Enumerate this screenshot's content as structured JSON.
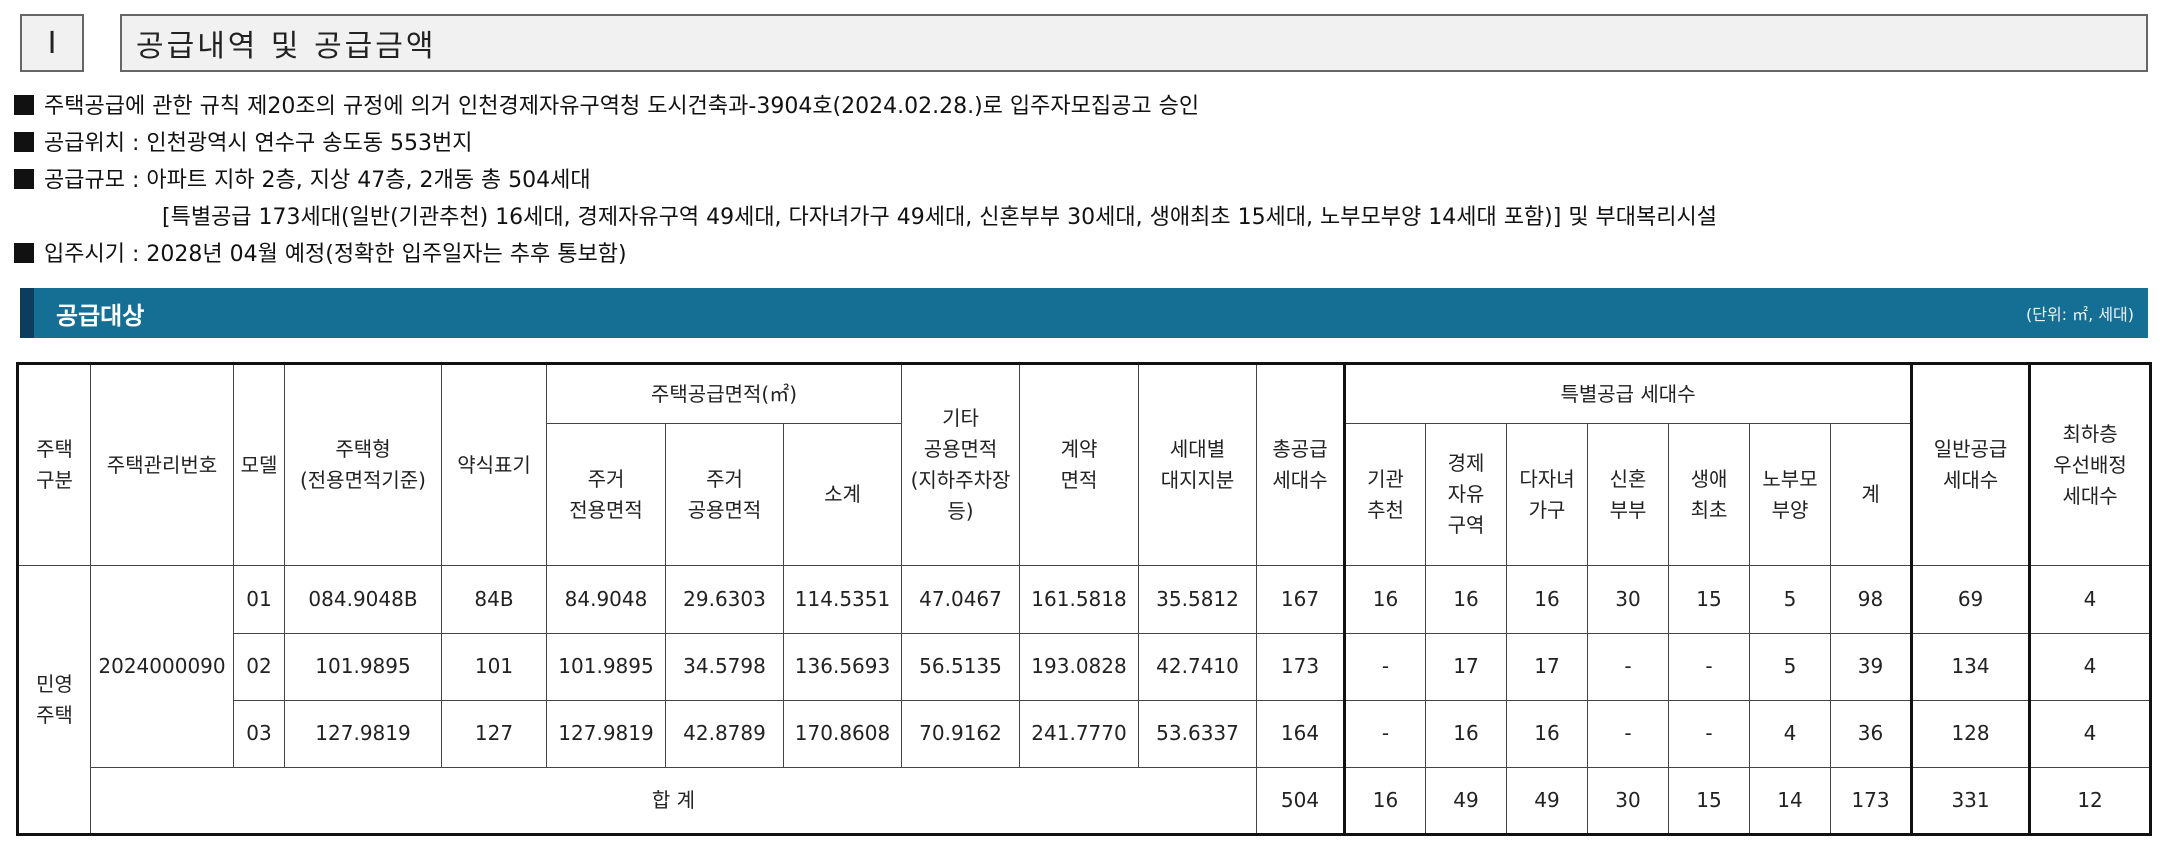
{
  "section": {
    "number": "Ⅰ",
    "title": "공급내역 및 공급금액"
  },
  "info": {
    "line1": "주택공급에 관한 규칙 제20조의 규정에 의거 인천경제자유구역청 도시건축과-3904호(2024.02.28.)로 입주자모집공고 승인",
    "line2": "공급위치 : 인천광역시 연수구 송도동 553번지",
    "line3": "공급규모 : 아파트 지하 2층, 지상 47층, 2개동 총 504세대",
    "line3b": "[특별공급 173세대(일반(기관추천) 16세대, 경제자유구역 49세대, 다자녀가구 49세대, 신혼부부 30세대, 생애최초 15세대, 노부모부양 14세대 포함)] 및 부대복리시설",
    "line4": "입주시기 : 2028년 04월 예정(정확한 입주일자는 추후 통보함)"
  },
  "bar": {
    "title": "공급대상",
    "unit": "(단위: ㎡, 세대)"
  },
  "table": {
    "headers": {
      "house_type_group": "주택\n구분",
      "mgmt_no": "주택관리번호",
      "model": "모델",
      "house_type": "주택형\n(전용면적기준)",
      "abbr": "약식표기",
      "area_group": "주택공급면적(㎡)",
      "exclusive": "주거\n전용면적",
      "shared": "주거\n공용면적",
      "subtotal": "소계",
      "other_shared": "기타\n공용면적\n(지하주차장\n등)",
      "contract_area": "계약\n면적",
      "land_share": "세대별\n대지지분",
      "total_supply": "총공급\n세대수",
      "special_group": "특별공급 세대수",
      "sp_agency": "기관\n추천",
      "sp_free_zone": "경제\n자유\n구역",
      "sp_multi_child": "다자녀\n가구",
      "sp_newlywed": "신혼\n부부",
      "sp_first": "생애\n최초",
      "sp_elderly": "노부모\n부양",
      "sp_sum": "계",
      "general": "일반공급\n세대수",
      "lowest_floor": "최하층\n우선배정\n세대수"
    },
    "group_label": "민영\n주택",
    "mgmt_no_value": "2024000090",
    "rows": [
      {
        "model": "01",
        "house_type": "084.9048B",
        "abbr": "84B",
        "exclusive": "84.9048",
        "shared": "29.6303",
        "subtotal": "114.5351",
        "other_shared": "47.0467",
        "contract_area": "161.5818",
        "land_share": "35.5812",
        "total_supply": "167",
        "sp_agency": "16",
        "sp_free_zone": "16",
        "sp_multi_child": "16",
        "sp_newlywed": "30",
        "sp_first": "15",
        "sp_elderly": "5",
        "sp_sum": "98",
        "general": "69",
        "lowest_floor": "4"
      },
      {
        "model": "02",
        "house_type": "101.9895",
        "abbr": "101",
        "exclusive": "101.9895",
        "shared": "34.5798",
        "subtotal": "136.5693",
        "other_shared": "56.5135",
        "contract_area": "193.0828",
        "land_share": "42.7410",
        "total_supply": "173",
        "sp_agency": "-",
        "sp_free_zone": "17",
        "sp_multi_child": "17",
        "sp_newlywed": "-",
        "sp_first": "-",
        "sp_elderly": "5",
        "sp_sum": "39",
        "general": "134",
        "lowest_floor": "4"
      },
      {
        "model": "03",
        "house_type": "127.9819",
        "abbr": "127",
        "exclusive": "127.9819",
        "shared": "42.8789",
        "subtotal": "170.8608",
        "other_shared": "70.9162",
        "contract_area": "241.7770",
        "land_share": "53.6337",
        "total_supply": "164",
        "sp_agency": "-",
        "sp_free_zone": "16",
        "sp_multi_child": "16",
        "sp_newlywed": "-",
        "sp_first": "-",
        "sp_elderly": "4",
        "sp_sum": "36",
        "general": "128",
        "lowest_floor": "4"
      }
    ],
    "total": {
      "label": "합 계",
      "total_supply": "504",
      "sp_agency": "16",
      "sp_free_zone": "49",
      "sp_multi_child": "49",
      "sp_newlywed": "30",
      "sp_first": "15",
      "sp_elderly": "14",
      "sp_sum": "173",
      "general": "331",
      "lowest_floor": "12"
    }
  }
}
